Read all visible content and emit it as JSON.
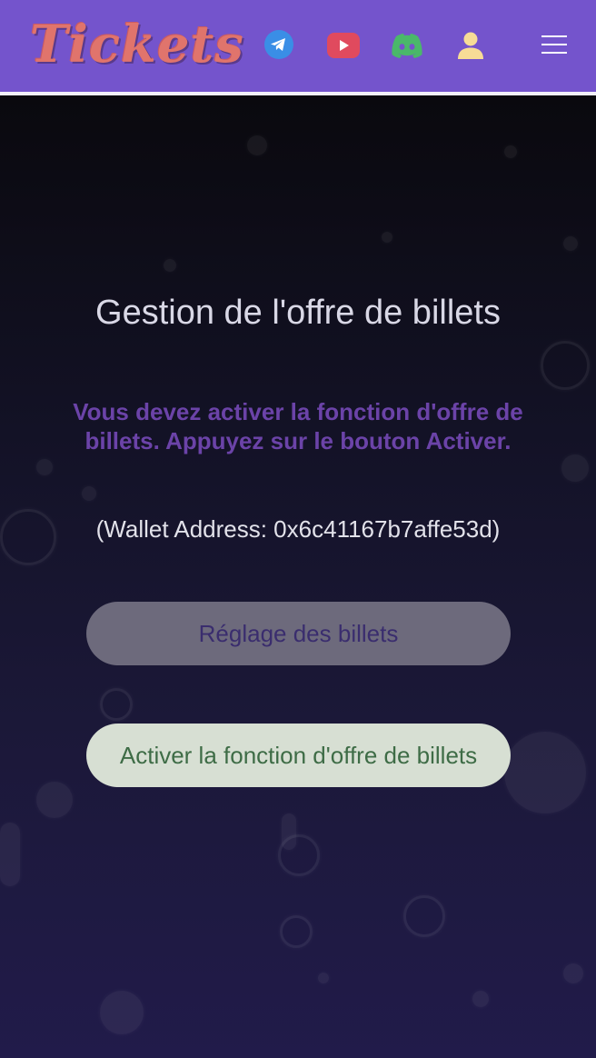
{
  "header": {
    "logo_text": "Tickets",
    "icons": [
      "telegram-icon",
      "youtube-icon",
      "discord-icon",
      "user-icon",
      "hamburger-menu-icon"
    ],
    "colors": {
      "background": "#7454cc",
      "telegram": "#3a8ee6",
      "youtube": "#e04a5e",
      "discord": "#4ab86a",
      "user": "#f7dc96"
    }
  },
  "main": {
    "title": "Gestion de l'offre de billets",
    "warning": "Vous devez activer la fonction d'offre de billets. Appuyez sur le bouton Activer.",
    "wallet_line": "(Wallet Address: 0x6c41167b7affe53d)",
    "settings_button": "Réglage des billets",
    "activate_button": "Activer la fonction d'offre de billets"
  }
}
